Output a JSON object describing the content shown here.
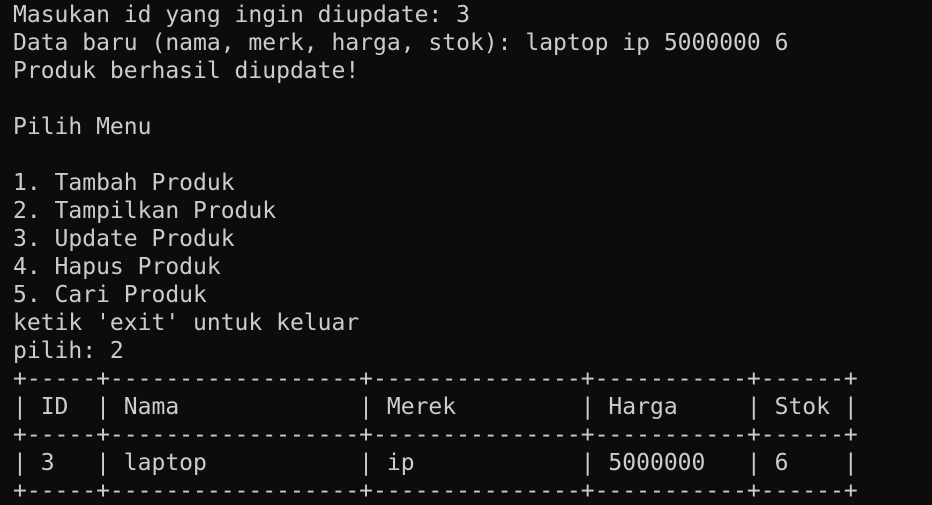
{
  "terminal": {
    "lines": [
      "Masukan id yang ingin diupdate: 3",
      "Data baru (nama, merk, harga, stok): laptop ip 5000000 6",
      "Produk berhasil diupdate!",
      "",
      "Pilih Menu",
      "",
      "1. Tambah Produk",
      "2. Tampilkan Produk",
      "3. Update Produk",
      "4. Hapus Produk",
      "5. Cari Produk",
      "ketik 'exit' untuk keluar",
      "pilih: 2"
    ],
    "table": {
      "border": "+-----+------------------+---------------+-----------+------+",
      "header": "| ID  | Nama             | Merek         | Harga     | Stok |",
      "rows": [
        "| 3   | laptop           | ip            | 5000000   | 6    |"
      ]
    }
  }
}
